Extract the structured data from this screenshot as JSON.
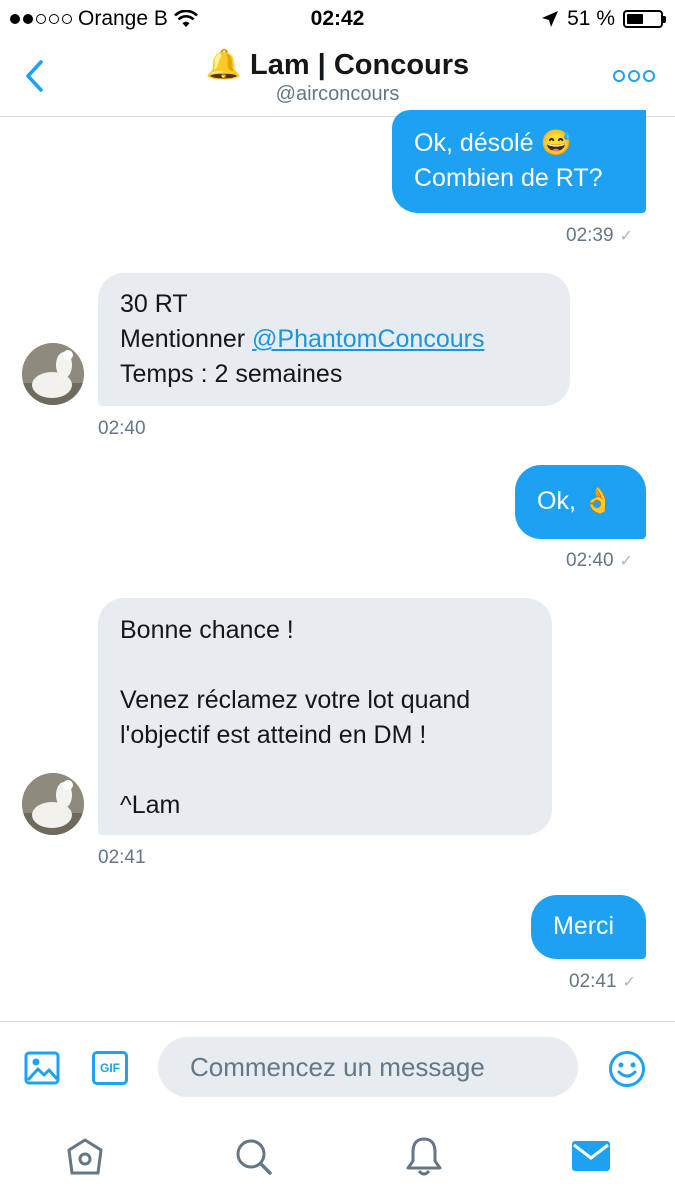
{
  "status_bar": {
    "carrier": "Orange B",
    "time": "02:42",
    "battery": "51 %",
    "battery_level": 0.51
  },
  "header": {
    "title_emoji": "🔔",
    "title": "Lam | Concours",
    "handle": "@airconcours"
  },
  "messages": [
    {
      "direction": "out",
      "lines": [
        "Ok, désolé 😅",
        "Combien de RT?"
      ],
      "time": "02:39"
    },
    {
      "direction": "in",
      "lines": [
        "30 RT",
        "Mentionner ",
        "Temps : 2 semaines"
      ],
      "mention": "@PhantomConcours",
      "time": "02:40"
    },
    {
      "direction": "out",
      "lines": [
        "Ok, 👌"
      ],
      "time": "02:40"
    },
    {
      "direction": "in",
      "lines": [
        "Bonne chance !",
        "",
        "Venez réclamez votre lot quand",
        "l'objectif est atteind en DM !",
        "",
        "^Lam"
      ],
      "time": "02:41"
    },
    {
      "direction": "out",
      "lines": [
        "Merci"
      ],
      "time": "02:41"
    }
  ],
  "composer": {
    "placeholder": "Commencez un message",
    "gif_label": "GIF"
  },
  "tabs": [
    "home",
    "search",
    "notifications",
    "messages"
  ],
  "colors": {
    "accent": "#1da1f2",
    "bubble_incoming": "#e6ecf0",
    "muted": "#657786",
    "link": "#1b95e0"
  },
  "icons": [
    "back-chevron-icon",
    "more-dots-icon",
    "image-icon",
    "gif-icon",
    "emoji-icon",
    "home-icon",
    "search-icon",
    "bell-icon",
    "mail-icon"
  ]
}
